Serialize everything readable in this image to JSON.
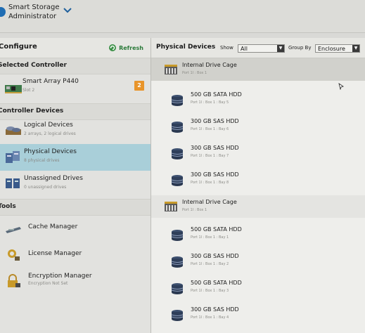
{
  "app": {
    "title": "Smart Storage Administrator"
  },
  "configure": {
    "title": "Configure",
    "refresh_label": "Refresh"
  },
  "selected_controller": {
    "section_label": "Selected Controller",
    "name": "Smart Array P440",
    "slot": "Slot 2",
    "badge": "2"
  },
  "controller_devices": {
    "section_label": "Controller Devices",
    "items": [
      {
        "label": "Logical Devices",
        "sub": "2 arrays, 2 logical drives",
        "icon": "logical-devices-icon"
      },
      {
        "label": "Physical Devices",
        "sub": "8 physical drives",
        "icon": "physical-devices-icon",
        "selected": true
      },
      {
        "label": "Unassigned Drives",
        "sub": "0 unassigned drives",
        "icon": "unassigned-drives-icon"
      }
    ]
  },
  "tools": {
    "section_label": "Tools",
    "items": [
      {
        "label": "Cache Manager",
        "sub": "",
        "icon": "cache-manager-icon"
      },
      {
        "label": "License Manager",
        "sub": "",
        "icon": "license-manager-icon"
      },
      {
        "label": "Encryption Manager",
        "sub": "Encryption Not Set",
        "icon": "encryption-manager-icon"
      }
    ]
  },
  "physical_devices": {
    "title": "Physical Devices",
    "show_label": "Show",
    "show_value": "All",
    "group_by_label": "Group By",
    "group_by_value": "Enclosure",
    "cages": [
      {
        "label": "Internal Drive Cage",
        "sub": "Port 1I : Box 1",
        "drives": [
          {
            "label": "500 GB SATA HDD",
            "sub": "Port 1I : Box 1 : Bay 5"
          },
          {
            "label": "300 GB SAS HDD",
            "sub": "Port 1I : Box 1 : Bay 6"
          },
          {
            "label": "300 GB SAS HDD",
            "sub": "Port 1I : Box 1 : Bay 7"
          },
          {
            "label": "300 GB SAS HDD",
            "sub": "Port 1I : Box 1 : Bay 8"
          }
        ]
      },
      {
        "label": "Internal Drive Cage",
        "sub": "Port 1I : Box 1",
        "drives": [
          {
            "label": "500 GB SATA HDD",
            "sub": "Port 1I : Box 1 : Bay 1"
          },
          {
            "label": "300 GB SAS HDD",
            "sub": "Port 1I : Box 1 : Bay 2"
          },
          {
            "label": "500 GB SATA HDD",
            "sub": "Port 1I : Box 1 : Bay 3"
          },
          {
            "label": "300 GB SAS HDD",
            "sub": "Port 1I : Box 1 : Bay 4"
          }
        ]
      }
    ]
  },
  "colors": {
    "selection": "#a9cfd9",
    "badge": "#e8942a",
    "refresh": "#2b7a3a"
  }
}
